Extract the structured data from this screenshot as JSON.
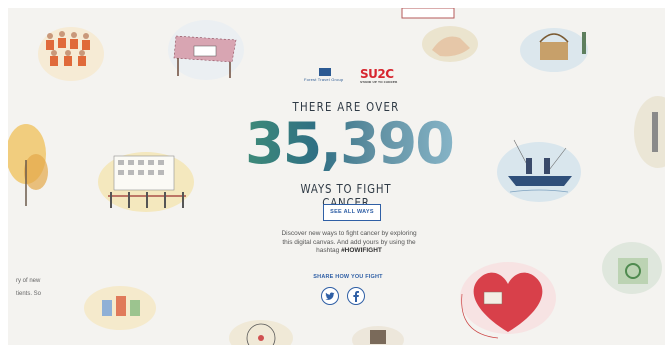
{
  "header": {
    "sponsor_left": "Forest Travel Group",
    "sponsor_right": "SU2C",
    "sponsor_right_sub": "STAND UP TO CANCER"
  },
  "hero": {
    "pre_title": "THERE ARE OVER",
    "count": "35,390",
    "post_title": "WAYS TO FIGHT CANCER",
    "cta_label": "SEE ALL WAYS",
    "description": "Discover new ways to fight cancer by exploring this digital canvas. And add yours by using the hashtag",
    "hashtag": "#HOWIFIGHT"
  },
  "share": {
    "label": "SHARE HOW YOU FIGHT",
    "buttons": [
      {
        "icon": "twitter-icon"
      },
      {
        "icon": "facebook-icon"
      }
    ]
  },
  "left_fragment": {
    "line1": "ry of new",
    "line2": "tients. So"
  },
  "colors": {
    "accent": "#2f5fa5",
    "number_gradient_start": "#3e8b78",
    "number_gradient_end": "#86b4c7",
    "canvas_bg": "#f4f3f0"
  }
}
